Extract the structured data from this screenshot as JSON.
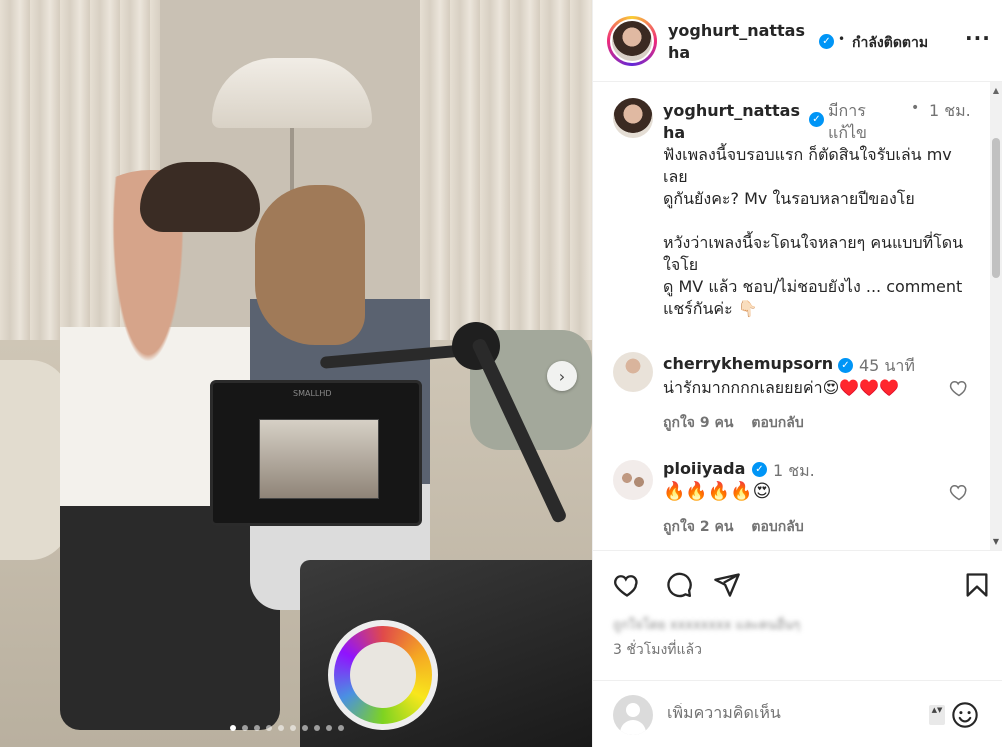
{
  "header": {
    "username": "yoghurt_nattasha",
    "verified_mark": "✓",
    "dot": "•",
    "follow_status": "กำลังติดตาม",
    "more_label": "···"
  },
  "media": {
    "monitor_label": "SMALLHD",
    "next_arrow": "›",
    "slide_count": 10,
    "active_slide": 1
  },
  "caption": {
    "username": "yoghurt_nattasha",
    "edited": "มีการแก้ไข",
    "dot": "•",
    "time": "1 ชม.",
    "lines": [
      "ฟังเพลงนี้จบรอบแรก ก็ตัดสินใจรับเล่น mv เลย",
      "ดูกันยังคะ? Mv ในรอบหลายปีของโย",
      "",
      "หวังว่าเพลงนี้จะโดนใจหลายๆ คนแบบที่โดนใจโย",
      "ดู MV แล้ว ชอบ/ไม่ชอบยังไง ... comment แชร์กันค่ะ 👇🏻"
    ]
  },
  "comments": [
    {
      "username": "cherrykhemupsorn",
      "time": "45 นาที",
      "text": "น่ารักมากกกกเลยยยค่า😍♥️♥️♥️",
      "likes": "ถูกใจ 9 คน",
      "reply": "ตอบกลับ"
    },
    {
      "username": "ploiiyada",
      "time": "1 ชม.",
      "text": "🔥🔥🔥🔥😍",
      "likes": "ถูกใจ 2 คน",
      "reply": "ตอบกลับ"
    }
  ],
  "post": {
    "likes_blurred": "ถูกใจโดย xxxxxxxx และคนอื่นๆ",
    "time_ago": "3 ชั่วโมงที่แล้ว"
  },
  "add_comment": {
    "placeholder": "เพิ่มความคิดเห็น",
    "stepper": "▲▼"
  },
  "scrollbar": {
    "up": "▲",
    "down": "▼"
  },
  "colors": {
    "verified": "#0095f6",
    "text": "#262626",
    "secondary": "#737373",
    "border": "#efefef"
  }
}
